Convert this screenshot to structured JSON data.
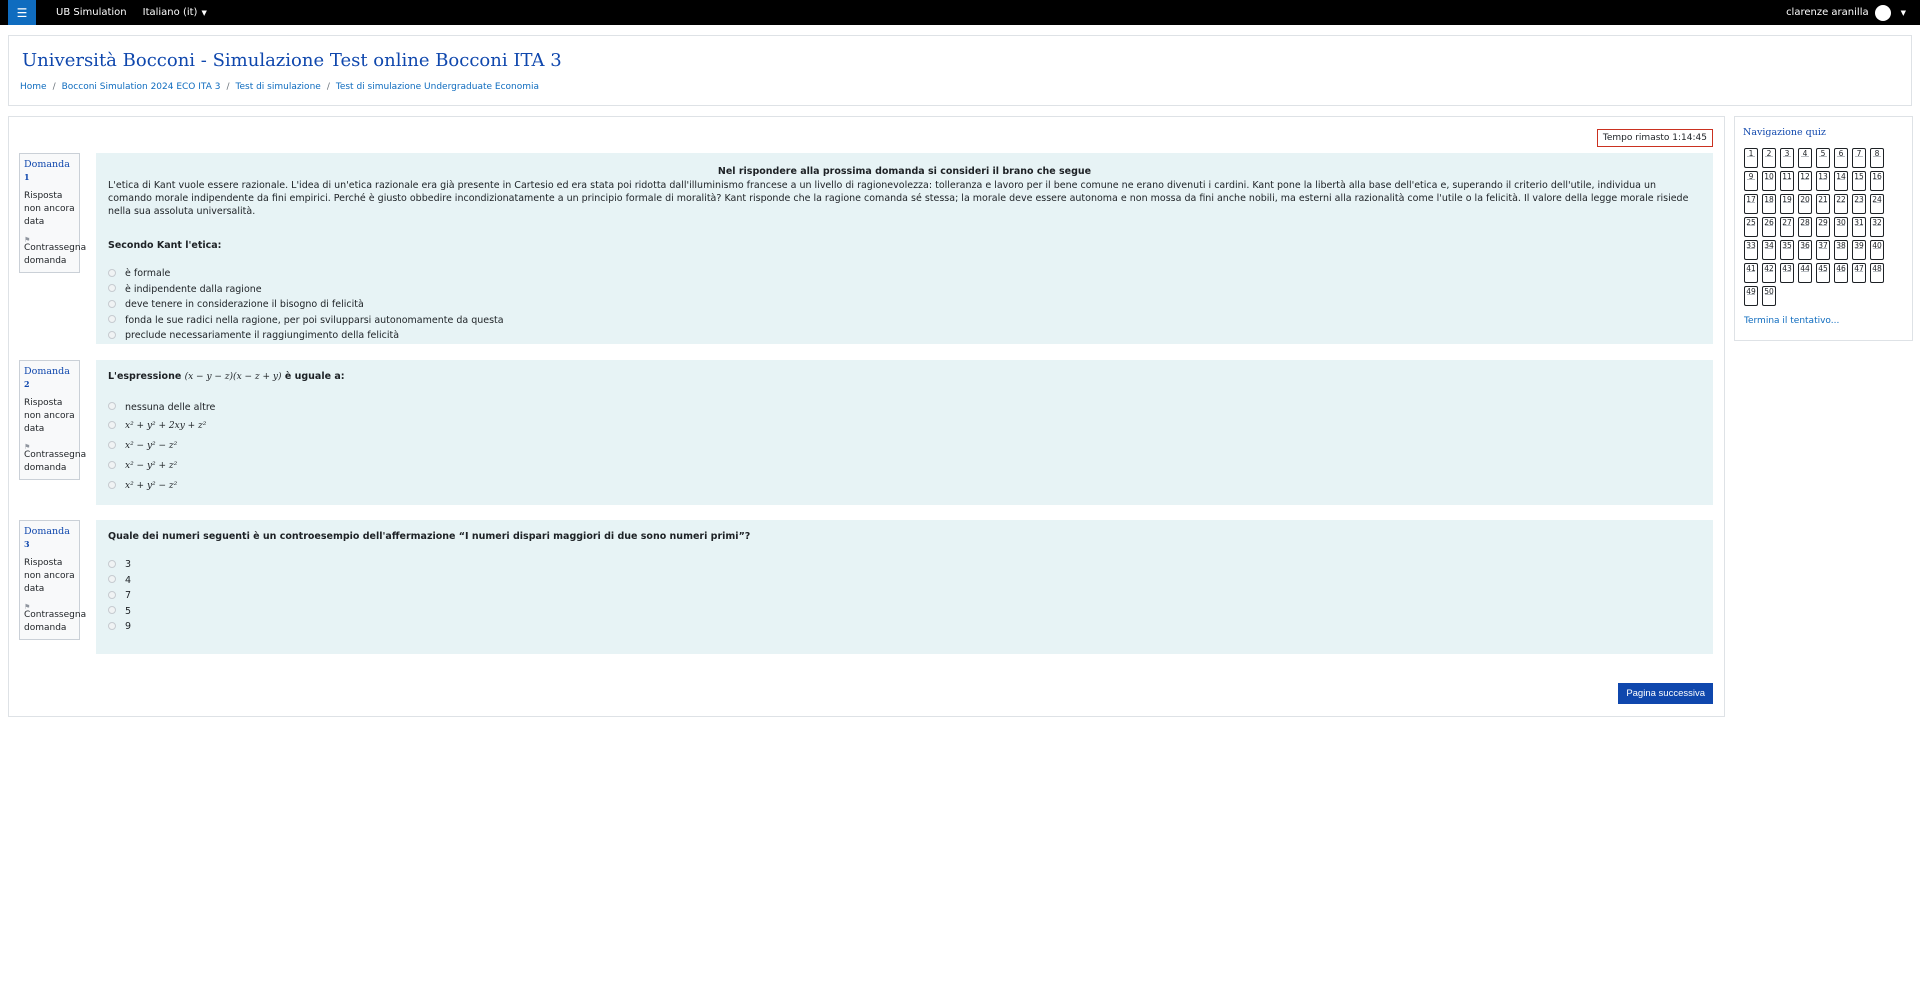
{
  "navbar": {
    "menu_icon": "hamburger-icon",
    "brand": "UB Simulation",
    "language": "Italiano (it)",
    "user_name": "clarenze aranilla"
  },
  "header": {
    "title": "Università Bocconi - Simulazione Test online Bocconi ITA 3",
    "breadcrumb": [
      "Home",
      "Bocconi Simulation 2024 ECO ITA 3",
      "Test di simulazione",
      "Test di simulazione Undergraduate Economia"
    ]
  },
  "quiz": {
    "timer": "Tempo rimasto 1:14:45",
    "next_button": "Pagina successiva",
    "questions": [
      {
        "label": "Domanda",
        "number": "1",
        "state": "Risposta non ancora data",
        "flag": "Contrassegna domanda",
        "intro_title": "Nel rispondere alla prossima domanda si consideri il brano che segue",
        "intro_text": "L'etica di Kant vuole essere razionale. L'idea di un'etica razionale era già presente in Cartesio ed era stata poi ridotta dall'illuminismo francese a un livello di ragionevolezza: tolleranza e lavoro per il bene comune ne erano divenuti i cardini. Kant pone la libertà alla base dell'etica e, superando il criterio dell'utile, individua un comando morale indipendente da fini empirici. Perché è giusto obbedire incondizionatamente a un principio formale di moralità? Kant risponde che la ragione comanda sé stessa; la morale deve essere autonoma e non mossa da fini anche nobili, ma esterni alla razionalità come l'utile o la felicità. Il valore della legge morale risiede nella sua assoluta universalità.",
        "text": "Secondo Kant l'etica:",
        "answers": [
          "è formale",
          "è indipendente dalla ragione",
          "deve tenere in considerazione il bisogno di felicità",
          "fonda le sue radici nella ragione, per poi svilupparsi autonomamente da questa",
          "preclude necessariamente il raggiungimento della felicità"
        ]
      },
      {
        "label": "Domanda",
        "number": "2",
        "state": "Risposta non ancora data",
        "flag": "Contrassegna domanda",
        "text_before": "L'espressione",
        "expression": "(x − y − z)(x − z + y)",
        "text_after": "è uguale a:",
        "answers": [
          "nessuna delle altre",
          "x² + y² + 2xy + z²",
          "x² − y² − z²",
          "x² − y² + z²",
          "x² + y² − z²"
        ]
      },
      {
        "label": "Domanda",
        "number": "3",
        "state": "Risposta non ancora data",
        "flag": "Contrassegna domanda",
        "text": "Quale dei numeri seguenti è un controesempio dell'affermazione “I numeri dispari maggiori di due sono numeri primi”?",
        "answers": [
          "3",
          "4",
          "7",
          "5",
          "9"
        ]
      }
    ]
  },
  "navigation": {
    "title": "Navigazione quiz",
    "buttons": [
      "1",
      "2",
      "3",
      "4",
      "5",
      "6",
      "7",
      "8",
      "9",
      "10",
      "11",
      "12",
      "13",
      "14",
      "15",
      "16",
      "17",
      "18",
      "19",
      "20",
      "21",
      "22",
      "23",
      "24",
      "25",
      "26",
      "27",
      "28",
      "29",
      "30",
      "31",
      "32",
      "33",
      "34",
      "35",
      "36",
      "37",
      "38",
      "39",
      "40",
      "41",
      "42",
      "43",
      "44",
      "45",
      "46",
      "47",
      "48",
      "49",
      "50"
    ],
    "finish": "Termina il tentativo..."
  }
}
